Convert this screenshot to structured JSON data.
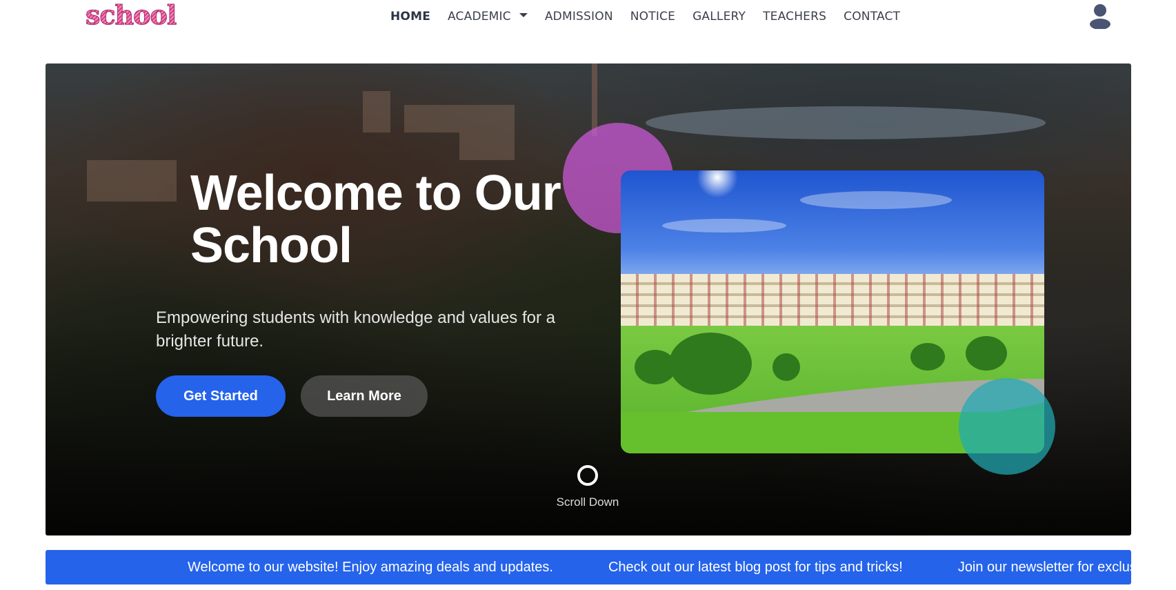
{
  "brand": {
    "logo_text": "school"
  },
  "nav": {
    "items": [
      {
        "label": "HOME",
        "active": true
      },
      {
        "label": "ACADEMIC",
        "has_dropdown": true
      },
      {
        "label": "ADMISSION"
      },
      {
        "label": "NOTICE"
      },
      {
        "label": "GALLERY"
      },
      {
        "label": "TEACHERS"
      },
      {
        "label": "CONTACT"
      }
    ],
    "user_icon": "user-icon"
  },
  "hero": {
    "title": "Welcome to Our School",
    "subtitle": "Empowering students with knowledge and values for a brighter future.",
    "primary_button": "Get Started",
    "secondary_button": "Learn More",
    "scroll_label": "Scroll Down"
  },
  "ticker": {
    "items": [
      "Welcome to our website! Enjoy amazing deals and updates.",
      "Check out our latest blog post for tips and tricks!",
      "Join our newsletter for exclusive offers."
    ]
  },
  "colors": {
    "accent": "#2563eb",
    "logo": "#d43f86",
    "pink_circle": "#ce5adc",
    "teal_circle": "#20aab4"
  }
}
